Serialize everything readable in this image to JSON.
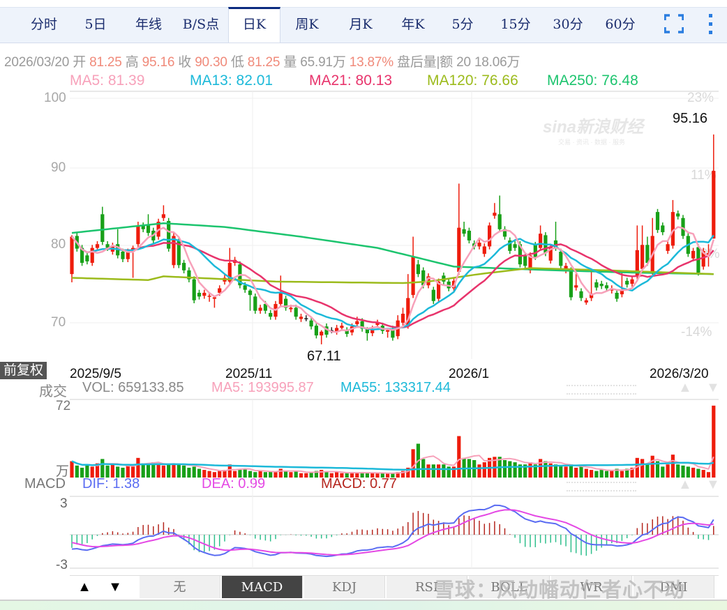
{
  "toolbar": {
    "tabs": [
      "分时",
      "5日",
      "年线",
      "B/S点",
      "日K",
      "周K",
      "月K",
      "年K",
      "5分",
      "15分",
      "30分",
      "60分"
    ],
    "active": "日K",
    "fullscreen_icon": "fullscreen-icon",
    "more_icon": "more-vertical-icon"
  },
  "info": {
    "date": "2026/03/20",
    "open_label": "开",
    "open": "81.25",
    "high_label": "高",
    "high": "95.16",
    "close_label": "收",
    "close": "90.30",
    "low_label": "低",
    "low": "81.25",
    "vol_label": "量",
    "vol": "65.91万",
    "change": "13.87%",
    "after_label": "盘后量|额",
    "after_vol": "20",
    "after_amt": "18.06万"
  },
  "ma_legend": {
    "ma5": "MA5: 81.39",
    "ma13": "MA13: 82.01",
    "ma21": "MA21: 80.13",
    "ma120": "MA120: 76.66",
    "ma250": "MA250: 76.48"
  },
  "colors": {
    "up": "#ee1c0c",
    "down": "#18a018",
    "ma5": "#f7a1ba",
    "ma13": "#1cb9d9",
    "ma21": "#e8346c",
    "ma120": "#9cbb1c",
    "ma250": "#1cc46e",
    "dif": "#5a6cf2",
    "dea": "#e448e4",
    "macd_up": "#b5261e",
    "macd_down": "#2fbf8c",
    "vol_ma5": "#f7a1ba",
    "vol_ma55": "#1cb9d9"
  },
  "price_axis": {
    "labels": [
      "100",
      "90",
      "80",
      "70"
    ],
    "pct_labels": [
      "23%",
      "11%",
      "0%",
      "-14%"
    ]
  },
  "markers": {
    "high": "95.16",
    "low": "67.11"
  },
  "price_mode": "前复权",
  "dates": [
    "2025/9/5",
    "2025/11",
    "2026/1",
    "2026/3/20"
  ],
  "vol_legend": {
    "label": "成交",
    "vol": "VOL: 659133.85",
    "ma5": "MA5: 193995.87",
    "ma55": "MA55: 133317.44"
  },
  "vol_axis": {
    "top": "72",
    "unit": "万"
  },
  "macd_legend": {
    "label": "MACD",
    "dif": "DIF: 1.38",
    "dea": "DEA: 0.99",
    "macd": "MACD: 0.77"
  },
  "macd_axis": {
    "top": "3",
    "bottom": "-3"
  },
  "bottom_tabs": {
    "up": "▲",
    "down": "▼",
    "tabs": [
      "无",
      "MACD",
      "KDJ",
      "RSI",
      "BOLL",
      "WR",
      "DMI"
    ],
    "active": "MACD"
  },
  "watermark": {
    "sina": "sina新浪财经",
    "sina_sub": "交易 · 资讯 · 数据 · 服务",
    "xueqiu": "雪球：风动幡动仁者心不动"
  },
  "chart_data": {
    "type": "candlestick",
    "title": "日K",
    "x_start": "2025/9/5",
    "x_end": "2026/3/20",
    "ylim": [
      67,
      100
    ],
    "candles_format": "[open, close, high?, low?]",
    "candles": [
      [
        76.5,
        81.5,
        81.7,
        75.4
      ],
      [
        81.6,
        79.9
      ],
      [
        80,
        78
      ],
      [
        79,
        78.2
      ],
      [
        78,
        80
      ],
      [
        80,
        80.5
      ],
      [
        84.5,
        80.8,
        85.5
      ],
      [
        80.5,
        80
      ],
      [
        79.5,
        80.3
      ],
      [
        80.5,
        79,
        82.5
      ],
      [
        79.5,
        78.5
      ],
      [
        78.5,
        79.5
      ],
      [
        79.5,
        80,
        80.3,
        76
      ],
      [
        80.5,
        83,
        83.5
      ],
      [
        83,
        82.5
      ],
      [
        83,
        82,
        84.5
      ],
      [
        82.3,
        81
      ],
      [
        81.5,
        83.5
      ],
      [
        84,
        84.5,
        85.7
      ],
      [
        83.6,
        79.9
      ],
      [
        77.7,
        81.6
      ],
      [
        81,
        77.7
      ],
      [
        78,
        77
      ],
      [
        77,
        75.8
      ],
      [
        75.8,
        73
      ],
      [
        74,
        73.5
      ],
      [
        73.6,
        74
      ],
      [
        73.5,
        73.6,
        74,
        72.8
      ],
      [
        73.2,
        73.4,
        73.6,
        72
      ],
      [
        74,
        74.6
      ],
      [
        75.5,
        76
      ],
      [
        75.5,
        78,
        80
      ],
      [
        78,
        78.4
      ],
      [
        77.8,
        75
      ],
      [
        75,
        74.4
      ],
      [
        74.3,
        73.7,
        74.5,
        71.6
      ],
      [
        73.5,
        71.6
      ],
      [
        71.6,
        72
      ],
      [
        72.5,
        71.6
      ],
      [
        71.3,
        70.8
      ],
      [
        70.8,
        72.5
      ],
      [
        72.5,
        74,
        76.3
      ],
      [
        73.2,
        72
      ],
      [
        71.8,
        72
      ],
      [
        72,
        70.8
      ],
      [
        70.5,
        70.8
      ],
      [
        70.6,
        70.6,
        71,
        70.2
      ],
      [
        70.3,
        69.5
      ],
      [
        69.6,
        68.3
      ],
      [
        68.3,
        68.8,
        69,
        67.11
      ],
      [
        69.5,
        68.4
      ],
      [
        69,
        69,
        69.4,
        68.6
      ],
      [
        68.8,
        69.3
      ],
      [
        69.3,
        69.6
      ],
      [
        69,
        68.5
      ],
      [
        68.7,
        69.5
      ],
      [
        69.8,
        70.2,
        70.8
      ],
      [
        70.2,
        69.2
      ],
      [
        69.2,
        68.6,
        69.4,
        67.6
      ],
      [
        68.6,
        69.2
      ],
      [
        69.7,
        70
      ],
      [
        69.6,
        68.9
      ],
      [
        68.8,
        69,
        69.3,
        68
      ],
      [
        69.2,
        68
      ],
      [
        68.2,
        70.3,
        71
      ],
      [
        70,
        71.2,
        72
      ],
      [
        69.6,
        73.3,
        76.5
      ],
      [
        73.7,
        78.9,
        81.5
      ],
      [
        77.8,
        76.5,
        78.4
      ],
      [
        77,
        75
      ],
      [
        75,
        76.2
      ],
      [
        74.4,
        72.9
      ],
      [
        73.2,
        75.5
      ],
      [
        76.3,
        75.5
      ],
      [
        75.5,
        74.6
      ],
      [
        74.6,
        75.6
      ],
      [
        76.8,
        82.7,
        88.6
      ],
      [
        82.5,
        81.9,
        83.5
      ],
      [
        82.3,
        81
      ],
      [
        80.6,
        80.2
      ],
      [
        80.2,
        80.7
      ],
      [
        79.2,
        80.2
      ],
      [
        80.2,
        83
      ],
      [
        84.3,
        84.7,
        86
      ],
      [
        84.5,
        82.5,
        87
      ],
      [
        82.5,
        81.5
      ],
      [
        81,
        79.6
      ],
      [
        80.5,
        80
      ],
      [
        80.5,
        77.8
      ],
      [
        79,
        77.6
      ],
      [
        77,
        79
      ],
      [
        80.4,
        78.8
      ],
      [
        80,
        81.9,
        83
      ],
      [
        81.7,
        79.3
      ],
      [
        78.3,
        80.1
      ],
      [
        81,
        80,
        83.5
      ],
      [
        79.5,
        77.6
      ],
      [
        77,
        77.6
      ],
      [
        77,
        73.4
      ],
      [
        74.7,
        75,
        77
      ],
      [
        74.2,
        73.3
      ],
      [
        72.7,
        73,
        73.3,
        72.4
      ],
      [
        73.3,
        73.9,
        77.2
      ],
      [
        75.4,
        74.7
      ],
      [
        75.2,
        74.9
      ],
      [
        75,
        74.6
      ],
      [
        74.3,
        74.6
      ],
      [
        74,
        73.2
      ],
      [
        73.8,
        74.4,
        76.7
      ],
      [
        75.6,
        75.1
      ],
      [
        75.2,
        75.8
      ],
      [
        76.2,
        79.7,
        83
      ],
      [
        77.2,
        80.4,
        83
      ],
      [
        80.4,
        78,
        81.5
      ],
      [
        76.8,
        81.6,
        84
      ],
      [
        84.8,
        82.4
      ],
      [
        83,
        82.1
      ],
      [
        79.6,
        80.5
      ],
      [
        80.3,
        84.8,
        86.4
      ],
      [
        84.6,
        84.2,
        85
      ],
      [
        84,
        81.6
      ],
      [
        81.6,
        79.2
      ],
      [
        78.6,
        79.6
      ],
      [
        80.1,
        76.7
      ],
      [
        77.5,
        79.6
      ],
      [
        78.9,
        79.3,
        80.5,
        77.5
      ],
      [
        81.25,
        90.3,
        95.16,
        81.25
      ]
    ],
    "volume_unit": "万",
    "volumes": [
      15,
      11,
      9,
      12,
      10,
      13,
      17,
      11,
      12,
      10,
      9,
      12,
      10,
      18,
      13,
      12,
      14,
      13,
      11,
      12,
      13,
      12,
      11,
      9,
      10,
      8,
      7,
      6,
      5,
      6,
      7,
      12,
      6,
      7,
      8,
      6,
      5,
      6,
      5,
      6,
      5,
      8,
      6,
      5,
      6,
      4,
      4,
      5,
      6,
      7,
      5,
      4,
      5,
      4,
      4,
      5,
      4,
      5,
      4,
      4,
      4,
      4,
      4,
      4,
      5,
      6,
      9,
      26,
      31,
      17,
      12,
      12,
      12,
      12,
      10,
      10,
      38,
      18,
      17,
      16,
      12,
      14,
      18,
      19,
      19,
      16,
      15,
      14,
      12,
      12,
      14,
      12,
      17,
      15,
      13,
      12,
      11,
      10,
      12,
      9,
      10,
      8,
      7,
      6,
      7,
      6,
      7,
      8,
      6,
      8,
      9,
      18,
      17,
      13,
      20,
      15,
      10,
      12,
      21,
      12,
      11,
      10,
      9,
      8,
      7,
      5,
      65.91
    ],
    "ma120_points": [
      [
        0,
        76
      ],
      [
        15,
        75.7
      ],
      [
        18,
        76.2
      ],
      [
        40,
        75.5
      ],
      [
        65,
        75.3
      ],
      [
        70,
        75.5
      ],
      [
        80,
        76.5
      ],
      [
        90,
        77.3
      ],
      [
        105,
        77
      ],
      [
        126,
        76.5
      ]
    ],
    "ma250_points": [
      [
        0,
        82
      ],
      [
        18,
        83.3
      ],
      [
        30,
        82.8
      ],
      [
        45,
        81.5
      ],
      [
        60,
        80
      ],
      [
        75,
        77.5
      ],
      [
        95,
        77
      ],
      [
        110,
        76.7
      ],
      [
        126,
        76.5
      ]
    ]
  }
}
